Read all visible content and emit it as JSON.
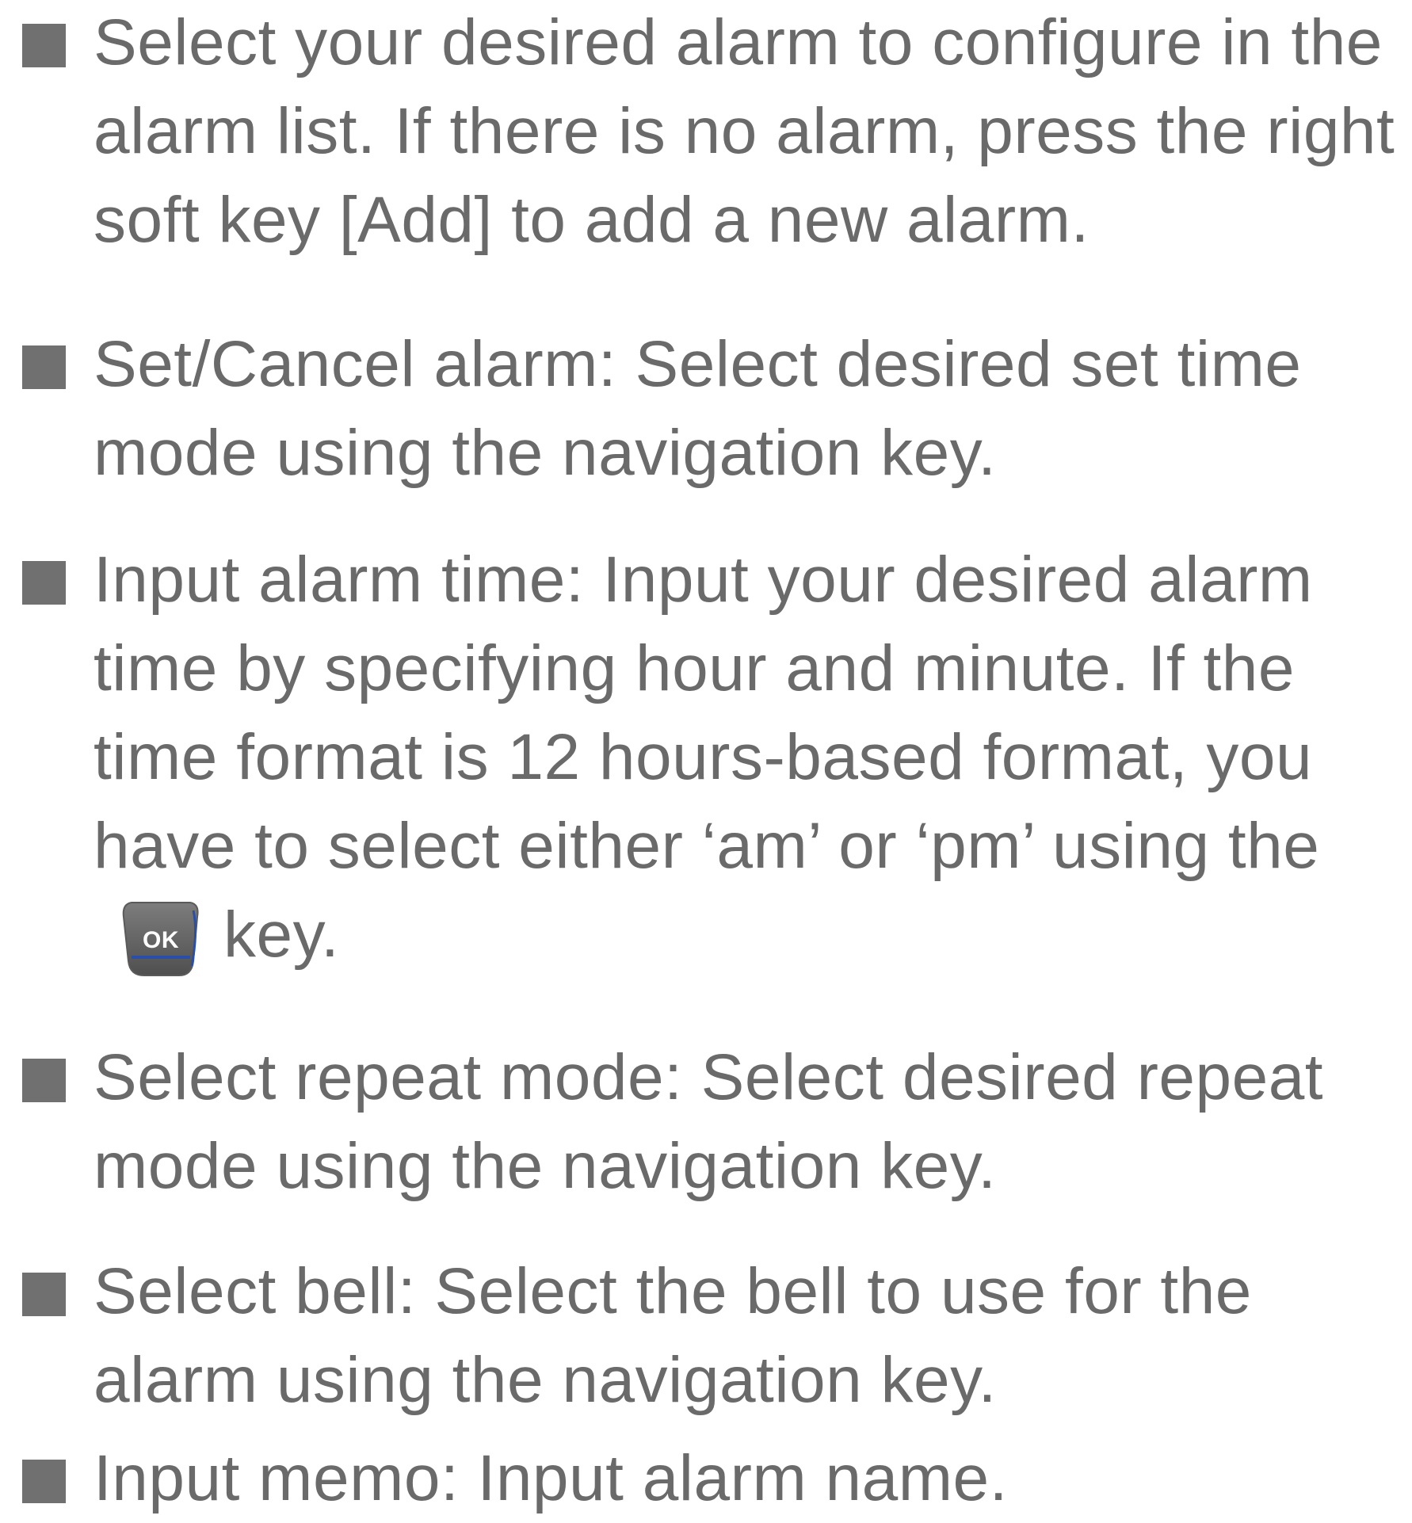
{
  "instructions": [
    {
      "lines": [
        "Select your desired alarm to configure in the",
        "alarm list. If there is no alarm, press the right",
        "soft key [Add] to add a new alarm."
      ]
    },
    {
      "lines": [
        "Set/Cancel alarm: Select desired set time",
        "mode using the navigation key."
      ]
    },
    {
      "lines": [
        "Input alarm time: Input your desired alarm",
        "time by specifying hour and minute. If the",
        "time format is 12 hours-based format, you",
        "have to select either ‘am’ or ‘pm’ using the"
      ],
      "key_line_suffix": "key.",
      "key_label": "OK",
      "key_icon": "ok-key-icon"
    },
    {
      "lines": [
        "Select repeat mode: Select desired repeat",
        "mode using the navigation key."
      ]
    },
    {
      "lines": [
        "Select bell: Select the bell to use for the",
        "alarm using the navigation key."
      ]
    },
    {
      "lines": [
        "Input memo: Input alarm name."
      ]
    }
  ],
  "colors": {
    "text": "#6a6a6a",
    "bullet": "#707070",
    "key_fill": "#6e6e6e",
    "key_underline": "#2a4fa8"
  }
}
